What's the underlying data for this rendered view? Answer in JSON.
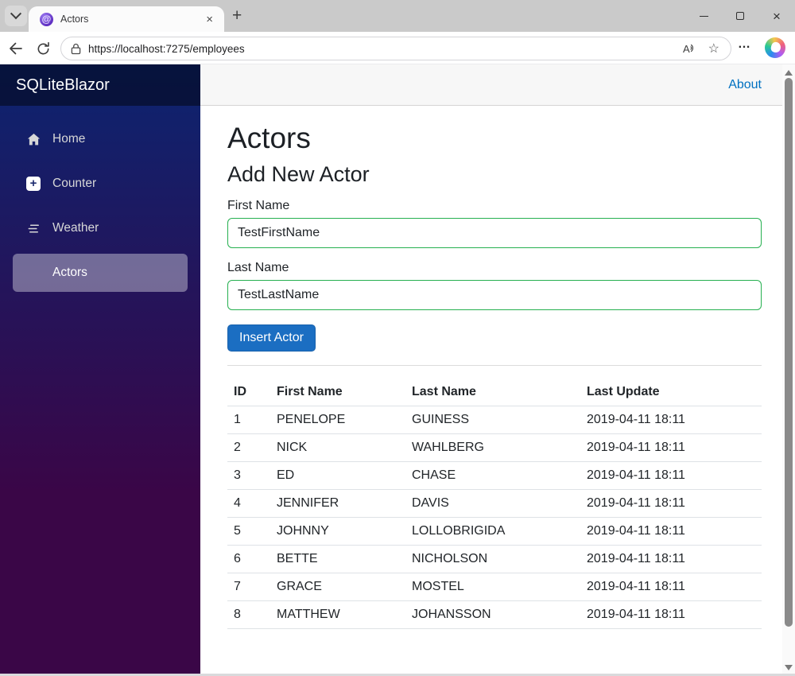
{
  "browser": {
    "tab_title": "Actors",
    "url": "https://localhost:7275/employees",
    "icons": {
      "tab_close": "×",
      "new_tab": "+",
      "favicon_glyph": "@",
      "read_aloud": "A",
      "star": "☆",
      "more": "…",
      "window_close": "×"
    }
  },
  "colors": {
    "accent_button_blue": "#1b6ec2",
    "valid_input_green": "#26b050",
    "link_blue": "#0071c1",
    "sidebar_gradient_top": "#0c2470",
    "sidebar_gradient_bottom": "#3a0647",
    "active_nav_bg": "rgba(255,255,255,0.37)"
  },
  "app": {
    "brand": "SQLiteBlazor",
    "nav": [
      {
        "label": "Home",
        "icon": "house-icon",
        "active": false
      },
      {
        "label": "Counter",
        "icon": "plus-square-icon",
        "active": false
      },
      {
        "label": "Weather",
        "icon": "list-nested-icon",
        "active": false
      },
      {
        "label": "Actors",
        "icon": "",
        "active": true
      }
    ],
    "top_bar": {
      "about_label": "About"
    },
    "page": {
      "title": "Actors",
      "form": {
        "heading": "Add New Actor",
        "first_name_label": "First Name",
        "first_name_value": "TestFirstName",
        "last_name_label": "Last Name",
        "last_name_value": "TestLastName",
        "submit_label": "Insert Actor"
      },
      "table": {
        "columns": [
          "ID",
          "First Name",
          "Last Name",
          "Last Update"
        ],
        "rows": [
          [
            "1",
            "PENELOPE",
            "GUINESS",
            "2019-04-11 18:11"
          ],
          [
            "2",
            "NICK",
            "WAHLBERG",
            "2019-04-11 18:11"
          ],
          [
            "3",
            "ED",
            "CHASE",
            "2019-04-11 18:11"
          ],
          [
            "4",
            "JENNIFER",
            "DAVIS",
            "2019-04-11 18:11"
          ],
          [
            "5",
            "JOHNNY",
            "LOLLOBRIGIDA",
            "2019-04-11 18:11"
          ],
          [
            "6",
            "BETTE",
            "NICHOLSON",
            "2019-04-11 18:11"
          ],
          [
            "7",
            "GRACE",
            "MOSTEL",
            "2019-04-11 18:11"
          ],
          [
            "8",
            "MATTHEW",
            "JOHANSSON",
            "2019-04-11 18:11"
          ]
        ]
      }
    }
  }
}
